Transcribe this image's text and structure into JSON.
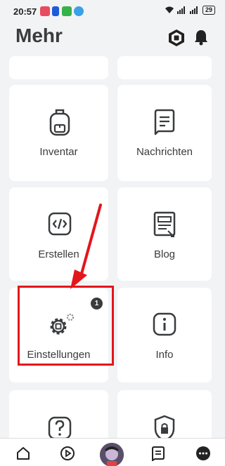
{
  "status_bar": {
    "time": "20:57",
    "battery": "29"
  },
  "header": {
    "title": "Mehr"
  },
  "grid": {
    "items": [
      {
        "label": "Inventar",
        "icon": "backpack-icon"
      },
      {
        "label": "Nachrichten",
        "icon": "chat-icon"
      },
      {
        "label": "Erstellen",
        "icon": "code-icon"
      },
      {
        "label": "Blog",
        "icon": "blog-icon"
      },
      {
        "label": "Einstellungen",
        "icon": "gear-icon",
        "badge": "1"
      },
      {
        "label": "Info",
        "icon": "info-icon"
      },
      {
        "label": "",
        "icon": "help-icon"
      },
      {
        "label": "",
        "icon": "shield-icon"
      }
    ]
  },
  "bottom_nav": {
    "items": [
      "home-icon",
      "play-icon",
      "avatar",
      "chat-icon",
      "more-icon"
    ]
  },
  "colors": {
    "background": "#f2f3f5",
    "card": "#ffffff",
    "text": "#393b3d",
    "highlight": "#e3161b"
  }
}
